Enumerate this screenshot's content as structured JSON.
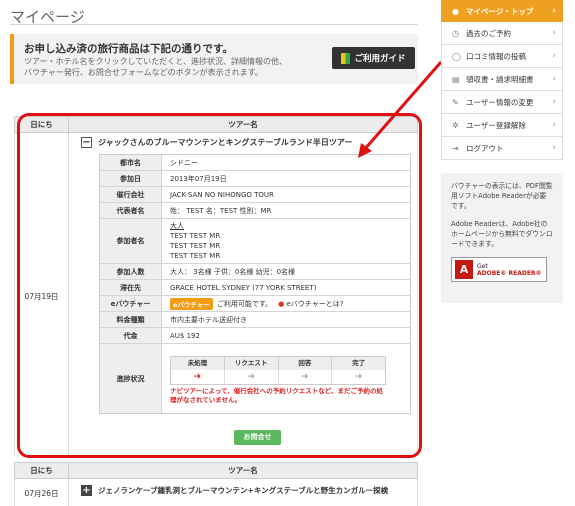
{
  "page": {
    "title": "マイページ"
  },
  "info": {
    "heading": "お申し込み済の旅行商品は下記の通りです。",
    "line1": "ツアー・ホテル名をクリックしていただくと、進捗状況、詳細情報の他、",
    "line2": "バウチャー発行、お問合せフォームなどのボタンが表示されます。",
    "guide_label": "ご利用ガイド"
  },
  "table": {
    "col_date": "日にち",
    "col_tour": "ツアー名"
  },
  "booking1": {
    "date": "07月19日",
    "tour_name": "ジャックさんのブルーマウンテンとキングステーブルランド半日ツアー",
    "toggle": "−",
    "details": {
      "city_k": "都市名",
      "city_v": "シドニー",
      "date_k": "参加日",
      "date_v": "2013年07月19日",
      "org_k": "催行会社",
      "org_v": "JACK-SAN NO NIHONGO TOUR",
      "rep_k": "代表者名",
      "rep_v": "姓： TEST 名：TEST 性別：MR",
      "part_k": "参加者名",
      "part_0": "大人",
      "part_1": "TEST TEST MR",
      "part_2": "TEST TEST MR",
      "part_3": "TEST TEST MR",
      "count_k": "参加人数",
      "count_v": "大人： 3名様 子供：0名様 幼児：0名様",
      "pickup_k": "滞在先",
      "pickup_v": "GRACE HOTEL SYDNEY (77 YORK STREET)",
      "evou_k": "eバウチャー",
      "evou_badge": "eバウチャー",
      "evou_text": "ご利用可能です。",
      "evou_link": "eバウチャーとは?",
      "price_type_k": "料金種類",
      "price_type_v": "市内主要ホテル送迎付き",
      "price_k": "代金",
      "price_v": "AU$ 192",
      "progress_k": "進捗状況",
      "progress_cols": [
        "未処理",
        "リクエスト",
        "回答",
        "完了"
      ],
      "progress_note": "ナビツアーによって、催行会社への予約リクエストなど、まだご予約の処理がなされていません。",
      "progress_current": 0
    },
    "inquiry_label": "お問合せ"
  },
  "booking2": {
    "date": "07月26日",
    "tour_name": "ジェノランケーブ鍾乳洞とブルーマウンテン+キングステーブルと野生カンガルー探検",
    "toggle": "+"
  },
  "sidebar": {
    "items": [
      {
        "label": "マイページ・トップ",
        "icon": "user-icon"
      },
      {
        "label": "過去のご予約",
        "icon": "history-icon"
      },
      {
        "label": "口コミ情報の投稿",
        "icon": "comment-icon"
      },
      {
        "label": "領収書・請求明細書",
        "icon": "receipt-icon"
      },
      {
        "label": "ユーザー情報の変更",
        "icon": "wrench-icon"
      },
      {
        "label": "ユーザー登録解除",
        "icon": "gear-icon"
      },
      {
        "label": "ログアウト",
        "icon": "logout-icon"
      }
    ],
    "pdf_note": "バウチャーの表示には、PDF閲覧用ソフトAdobe Readerが必要です。",
    "adobe_note": "Adobe Readerは、Adobe社のホームページから無料でダウンロードできます。",
    "adobe_get": "Get",
    "adobe_reader": "ADOBE® READER®"
  },
  "colors": {
    "accent": "#f0a020",
    "highlight": "#e01010",
    "alert": "#e02020",
    "inquiry": "#5cb85c"
  }
}
